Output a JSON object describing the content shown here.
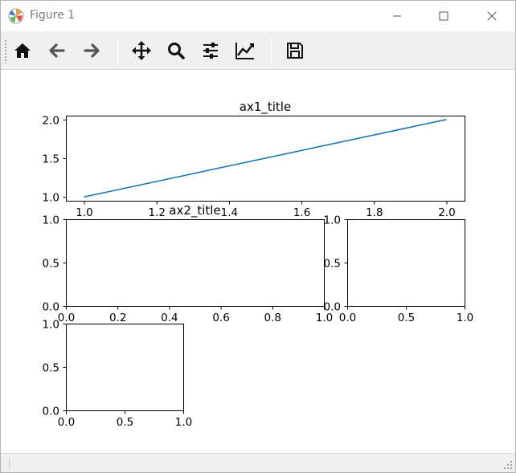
{
  "window": {
    "title": "Figure 1"
  },
  "toolbar": {
    "buttons": [
      {
        "name": "home",
        "icon": "home-icon"
      },
      {
        "name": "back",
        "icon": "arrow-left-icon"
      },
      {
        "name": "forward",
        "icon": "arrow-right-icon"
      },
      {
        "name": "pan",
        "icon": "move-icon"
      },
      {
        "name": "zoom",
        "icon": "search-icon"
      },
      {
        "name": "subplots",
        "icon": "sliders-icon"
      },
      {
        "name": "customize",
        "icon": "line-chart-icon"
      },
      {
        "name": "save",
        "icon": "save-icon"
      }
    ]
  },
  "colors": {
    "line": "#1f77b4",
    "toolbar_bg": "#f0f0f0",
    "icon": "#111111"
  },
  "chart_data": [
    {
      "type": "line",
      "title": "ax1_title",
      "x": [
        1.0,
        2.0
      ],
      "y": [
        1.0,
        2.0
      ],
      "xlim": [
        0.95,
        2.05
      ],
      "ylim": [
        0.95,
        2.05
      ],
      "xticks": [
        "1.0",
        "1.2",
        "1.4",
        "1.6",
        "1.8",
        "2.0"
      ],
      "yticks": [
        "1.0",
        "1.5",
        "2.0"
      ],
      "grid": false
    },
    {
      "type": "line",
      "title": "ax2_title",
      "xlim": [
        0,
        1
      ],
      "ylim": [
        0,
        1
      ],
      "xticks": [
        "0.0",
        "0.2",
        "0.4",
        "0.6",
        "0.8",
        "1.0"
      ],
      "yticks": [
        "0.0",
        "0.5",
        "1.0"
      ],
      "grid": false
    },
    {
      "type": "line",
      "title": "",
      "xlim": [
        0,
        1
      ],
      "ylim": [
        0,
        1
      ],
      "xticks": [
        "0.0",
        "0.5",
        "1.0"
      ],
      "yticks": [
        "0.0",
        "0.5",
        "1.0"
      ],
      "grid": false
    },
    {
      "type": "line",
      "title": "",
      "xlim": [
        0,
        1
      ],
      "ylim": [
        0,
        1
      ],
      "xticks": [
        "0.0",
        "0.5",
        "1.0"
      ],
      "yticks": [
        "0.0",
        "0.5",
        "1.0"
      ],
      "grid": false
    }
  ]
}
